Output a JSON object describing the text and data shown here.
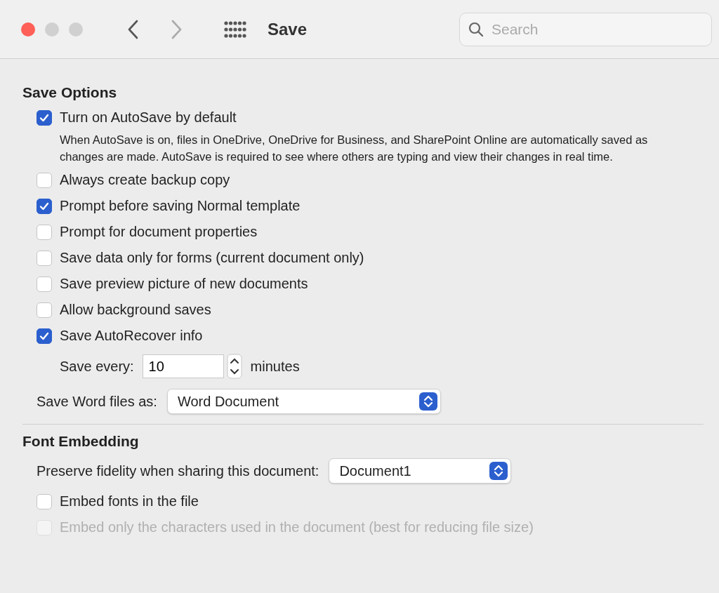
{
  "window": {
    "title": "Save"
  },
  "search": {
    "placeholder": "Search"
  },
  "sections": [
    {
      "title": "Save Options",
      "items": [
        {
          "kind": "checkbox",
          "label": "Turn on AutoSave by default",
          "checked": true,
          "disabled": false,
          "description": "When AutoSave is on, files in OneDrive, OneDrive for Business, and SharePoint Online are automatically saved as changes are made. AutoSave is required to see where others are typing and view their changes in real time."
        },
        {
          "kind": "checkbox",
          "label": "Always create backup copy",
          "checked": false,
          "disabled": false
        },
        {
          "kind": "checkbox",
          "label": "Prompt before saving Normal template",
          "checked": true,
          "disabled": false
        },
        {
          "kind": "checkbox",
          "label": "Prompt for document properties",
          "checked": false,
          "disabled": false
        },
        {
          "kind": "checkbox",
          "label": "Save data only for forms (current document only)",
          "checked": false,
          "disabled": false
        },
        {
          "kind": "checkbox",
          "label": "Save preview picture of new documents",
          "checked": false,
          "disabled": false
        },
        {
          "kind": "checkbox",
          "label": "Allow background saves",
          "checked": false,
          "disabled": false
        },
        {
          "kind": "checkbox",
          "label": "Save AutoRecover info",
          "checked": true,
          "disabled": false
        },
        {
          "kind": "number",
          "label": "Save every:",
          "value": "10",
          "unit": "minutes"
        },
        {
          "kind": "select",
          "label": "Save Word files as:",
          "value": "Word Document"
        }
      ]
    },
    {
      "title": "Font Embedding",
      "items": [
        {
          "kind": "select",
          "label": "Preserve fidelity when sharing this document:",
          "value": "Document1"
        },
        {
          "kind": "checkbox",
          "label": "Embed fonts in the file",
          "checked": false,
          "disabled": false
        },
        {
          "kind": "checkbox",
          "label": "Embed only the characters used in the document (best for reducing file size)",
          "checked": false,
          "disabled": true
        }
      ]
    }
  ]
}
